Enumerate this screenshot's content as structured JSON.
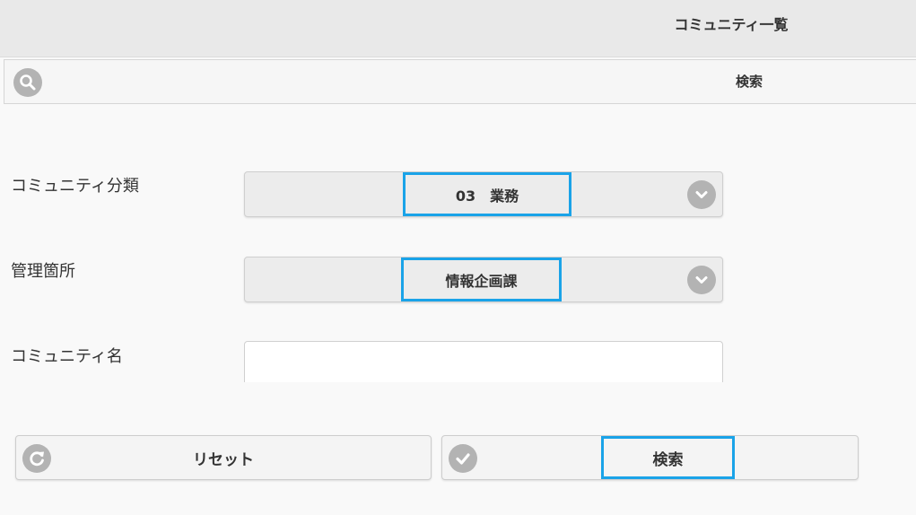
{
  "header": {
    "title": "コミュニティ一覧"
  },
  "search_bar": {
    "label": "検索",
    "icon": "search-icon"
  },
  "form": {
    "category": {
      "label": "コミュニティ分類",
      "selected": "03　業務",
      "icon": "chevron-down-icon"
    },
    "department": {
      "label": "管理箇所",
      "selected": "情報企画課",
      "icon": "chevron-down-icon"
    },
    "community_name": {
      "label": "コミュニティ名",
      "value": "",
      "placeholder": ""
    }
  },
  "buttons": {
    "reset": {
      "label": "リセット",
      "icon": "refresh-icon"
    },
    "search": {
      "label": "検索",
      "icon": "checkmark-icon"
    }
  },
  "colors": {
    "highlight": "#1aa3e8",
    "header_bg": "#e9e9e9",
    "icon_gray": "#b3b3b3"
  }
}
